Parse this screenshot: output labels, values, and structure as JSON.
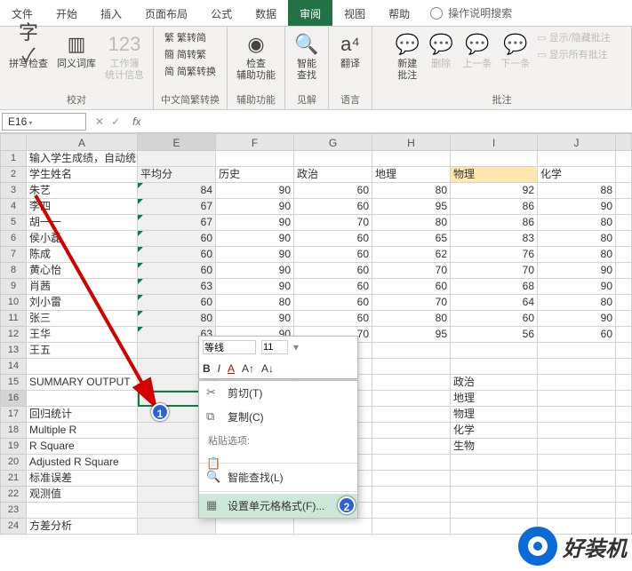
{
  "tabs": [
    "文件",
    "开始",
    "插入",
    "页面布局",
    "公式",
    "数据",
    "审阅",
    "视图",
    "帮助"
  ],
  "activeTab": 6,
  "tellMe": "操作说明搜索",
  "ribbon": {
    "g1": {
      "spell": "拼写检查",
      "thes": "同义词库",
      "stats": "工作簿\n统计信息",
      "label": "校对"
    },
    "g2": {
      "a": "繁转简",
      "b": "简转繁",
      "c": "简繁转换",
      "label": "中文简繁转换"
    },
    "g3": {
      "a": "检查\n辅助功能",
      "label": "辅助功能"
    },
    "g4": {
      "a": "智能\n查找",
      "label": "见解"
    },
    "g5": {
      "a": "翻译",
      "label": "语言"
    },
    "g6": {
      "a": "新建\n批注",
      "b": "删除",
      "c": "上一条",
      "d": "下一条",
      "e": "显示/隐藏批注",
      "f": "显示所有批注",
      "label": "批注"
    }
  },
  "namebox": "E16",
  "cols": [
    {
      "l": "A",
      "w": 125
    },
    {
      "l": "E",
      "w": 88
    },
    {
      "l": "F",
      "w": 88
    },
    {
      "l": "G",
      "w": 88
    },
    {
      "l": "H",
      "w": 88
    },
    {
      "l": "I",
      "w": 98
    },
    {
      "l": "J",
      "w": 88
    },
    {
      "l": "",
      "w": 18
    }
  ],
  "selCol": 1,
  "rows": [
    {
      "n": 1,
      "c": [
        "输入学生成绩，自动统计日期：X年X月X日",
        "",
        "",
        "",
        "",
        "",
        "",
        ""
      ]
    },
    {
      "n": 2,
      "c": [
        "学生姓名",
        "平均分",
        "历史",
        "政治",
        "地理",
        "物理",
        "化学",
        ""
      ],
      "hlCol": 5
    },
    {
      "n": 3,
      "c": [
        "朱艺",
        "84",
        "90",
        "60",
        "80",
        "92",
        "88",
        ""
      ],
      "num": 1
    },
    {
      "n": 4,
      "c": [
        "李四",
        "67",
        "90",
        "60",
        "95",
        "86",
        "90",
        ""
      ],
      "num": 1
    },
    {
      "n": 5,
      "c": [
        "胡一一",
        "67",
        "90",
        "70",
        "80",
        "86",
        "80",
        ""
      ],
      "num": 1
    },
    {
      "n": 6,
      "c": [
        "侯小磊",
        "60",
        "90",
        "60",
        "65",
        "83",
        "80",
        ""
      ],
      "num": 1
    },
    {
      "n": 7,
      "c": [
        "陈成",
        "60",
        "90",
        "60",
        "62",
        "76",
        "80",
        ""
      ],
      "num": 1
    },
    {
      "n": 8,
      "c": [
        "黄心怡",
        "60",
        "90",
        "60",
        "70",
        "70",
        "90",
        ""
      ],
      "num": 1
    },
    {
      "n": 9,
      "c": [
        "肖茜",
        "63",
        "90",
        "60",
        "60",
        "68",
        "90",
        ""
      ],
      "num": 1
    },
    {
      "n": 10,
      "c": [
        "刘小雷",
        "60",
        "80",
        "60",
        "70",
        "64",
        "80",
        ""
      ],
      "num": 1
    },
    {
      "n": 11,
      "c": [
        "张三",
        "80",
        "90",
        "60",
        "80",
        "60",
        "90",
        ""
      ],
      "num": 1
    },
    {
      "n": 12,
      "c": [
        "王华",
        "63",
        "90",
        "70",
        "95",
        "56",
        "60",
        ""
      ],
      "num": 1
    },
    {
      "n": 13,
      "c": [
        "王五",
        "",
        "",
        "",
        "",
        "",
        "",
        ""
      ]
    },
    {
      "n": 14,
      "c": [
        "",
        "",
        "",
        "",
        "",
        "",
        "",
        ""
      ]
    },
    {
      "n": 15,
      "c": [
        "SUMMARY OUTPUT",
        "",
        "",
        "",
        "",
        "政治",
        "",
        ""
      ]
    },
    {
      "n": 16,
      "c": [
        "",
        "",
        "",
        "",
        "",
        "地理",
        "",
        ""
      ],
      "active": 1
    },
    {
      "n": 17,
      "c": [
        "回归统计",
        "",
        "",
        "",
        "",
        "物理",
        "",
        ""
      ]
    },
    {
      "n": 18,
      "c": [
        "Multiple R",
        "",
        "",
        "",
        "",
        "化学",
        "",
        ""
      ]
    },
    {
      "n": 19,
      "c": [
        "R Square",
        "",
        "",
        "",
        "",
        "生物",
        "",
        ""
      ]
    },
    {
      "n": 20,
      "c": [
        "Adjusted R Square",
        "",
        "",
        "",
        "",
        "",
        "",
        ""
      ]
    },
    {
      "n": 21,
      "c": [
        "标准误差",
        "",
        "",
        "",
        "",
        "",
        "",
        ""
      ]
    },
    {
      "n": 22,
      "c": [
        "观测值",
        "",
        "",
        "",
        "",
        "",
        "",
        ""
      ]
    },
    {
      "n": 23,
      "c": [
        "",
        "",
        "",
        "",
        "",
        "",
        "",
        ""
      ]
    },
    {
      "n": 24,
      "c": [
        "方差分析",
        "",
        "",
        "",
        "",
        "",
        "",
        ""
      ]
    }
  ],
  "miniToolbar": {
    "font": "等线",
    "size": "11"
  },
  "ctx": {
    "cut": "剪切(T)",
    "copy": "复制(C)",
    "pasteOpt": "粘贴选项:",
    "smart": "智能查找(L)",
    "format": "设置单元格格式(F)..."
  },
  "watermark": "好装机"
}
